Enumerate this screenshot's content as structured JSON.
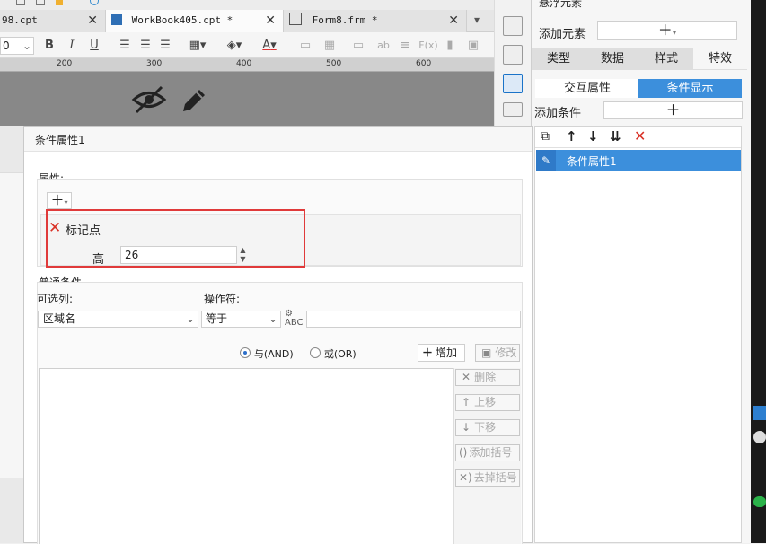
{
  "tabs": [
    {
      "label": "98.cpt",
      "close": "✕"
    },
    {
      "label": "WorkBook405.cpt *",
      "close": "✕"
    },
    {
      "label": "Form8.frm *",
      "close": "✕"
    }
  ],
  "toolbar": {
    "font_size": "0",
    "bold": "B",
    "italic": "I",
    "underline": "U",
    "text_color_a": "A",
    "ab": "ab",
    "fx": "F(x)"
  },
  "ruler": [
    "200",
    "300",
    "400",
    "500",
    "600"
  ],
  "right_panel": {
    "top_title": "悬浮元素",
    "add_element_label": "添加元素",
    "tabs": [
      "类型",
      "数据",
      "样式",
      "特效"
    ],
    "subtabs": [
      "交互属性",
      "条件显示"
    ],
    "add_condition_label": "添加条件",
    "conditions": [
      "条件属性1"
    ]
  },
  "dialog": {
    "title": "条件属性1",
    "attr_section": "属性:",
    "marker_label": "标记点",
    "height_label": "高",
    "height_value": "26",
    "common_section": "普通条件",
    "optional_col_label": "可选列:",
    "operator_label": "操作符:",
    "column_value": "区域名",
    "operator_value": "等于",
    "value_input": "",
    "and_label": "与(AND)",
    "or_label": "或(OR)",
    "add_btn": "增加",
    "modify_btn": "修改",
    "delete_btn": "删除",
    "up_btn": "上移",
    "down_btn": "下移",
    "add_bracket_btn": "添加括号",
    "remove_bracket_btn": "去掉括号"
  },
  "colors": {
    "accent": "#1a73c8",
    "selected_row": "#3c8fdc",
    "highlight_box": "#e03a3a",
    "delete_icon": "#d93025"
  }
}
